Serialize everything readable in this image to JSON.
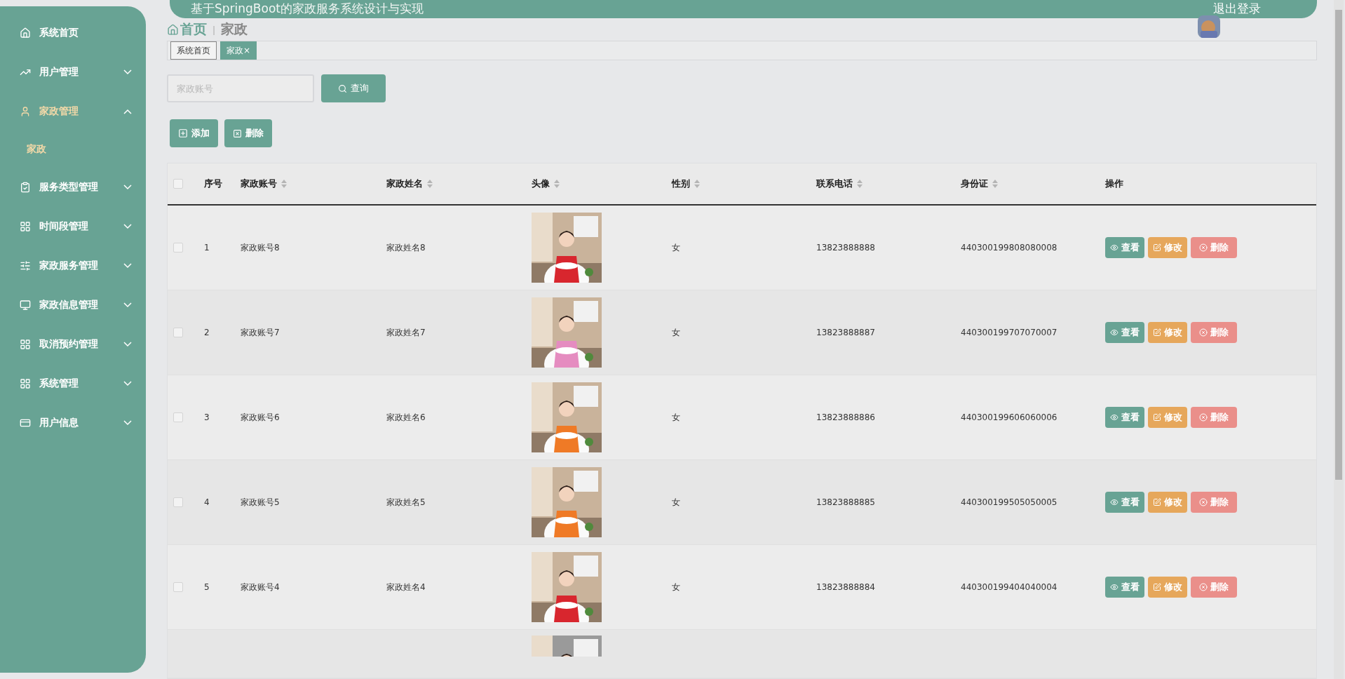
{
  "sidebar": {
    "items": [
      {
        "label": "系统首页",
        "kind": "link",
        "active": false
      },
      {
        "label": "用户管理",
        "kind": "group",
        "expanded": false,
        "active": false
      },
      {
        "label": "家政管理",
        "kind": "group",
        "expanded": true,
        "active": true,
        "children": [
          {
            "label": "家政",
            "selected": true
          }
        ]
      },
      {
        "label": "服务类型管理",
        "kind": "group",
        "expanded": false,
        "active": false
      },
      {
        "label": "时间段管理",
        "kind": "group",
        "expanded": false,
        "active": false
      },
      {
        "label": "家政服务管理",
        "kind": "group",
        "expanded": false,
        "active": false
      },
      {
        "label": "家政信息管理",
        "kind": "group",
        "expanded": false,
        "active": false
      },
      {
        "label": "取消预约管理",
        "kind": "group",
        "expanded": false,
        "active": false
      },
      {
        "label": "系统管理",
        "kind": "group",
        "expanded": false,
        "active": false
      },
      {
        "label": "用户信息",
        "kind": "group",
        "expanded": false,
        "active": false
      }
    ]
  },
  "header": {
    "title": "基于SpringBoot的家政服务系统设计与实现",
    "logout": "退出登录"
  },
  "breadcrumb": {
    "home": "首页",
    "separator": "ǀ",
    "current": "家政"
  },
  "tabs": [
    {
      "label": "系统首页",
      "selected": false
    },
    {
      "label": "家政",
      "selected": true,
      "close": "×"
    }
  ],
  "search": {
    "placeholder": "家政账号",
    "button": "查询"
  },
  "actions": {
    "add": "添加",
    "delete": "删除"
  },
  "table": {
    "columns": [
      {
        "label": "序号",
        "kind": "plain"
      },
      {
        "label": "家政账号",
        "kind": "sortable"
      },
      {
        "label": "家政姓名",
        "kind": "sortable"
      },
      {
        "label": "头像",
        "kind": "sortable"
      },
      {
        "label": "性别",
        "kind": "sortable"
      },
      {
        "label": "联系电话",
        "kind": "sortable"
      },
      {
        "label": "身份证",
        "kind": "sortable"
      },
      {
        "label": "操作",
        "kind": "plain"
      }
    ],
    "all_checked": false,
    "rows": [
      {
        "checked": false,
        "index": "1",
        "account": "家政账号8",
        "name": "家政姓名8",
        "gender": "女",
        "phone": "13823888888",
        "id_card": "440300199808080008",
        "buttons": [
          {
            "kind": "view",
            "label": "查看"
          },
          {
            "kind": "edit",
            "label": "修改"
          },
          {
            "kind": "delete",
            "label": "删除"
          }
        ]
      },
      {
        "checked": false,
        "index": "2",
        "account": "家政账号7",
        "name": "家政姓名7",
        "gender": "女",
        "phone": "13823888887",
        "id_card": "440300199707070007",
        "buttons": [
          {
            "kind": "view",
            "label": "查看"
          },
          {
            "kind": "edit",
            "label": "修改"
          },
          {
            "kind": "delete",
            "label": "删除"
          }
        ]
      },
      {
        "checked": false,
        "index": "3",
        "account": "家政账号6",
        "name": "家政姓名6",
        "gender": "女",
        "phone": "13823888886",
        "id_card": "440300199606060006",
        "buttons": [
          {
            "kind": "view",
            "label": "查看"
          },
          {
            "kind": "edit",
            "label": "修改"
          },
          {
            "kind": "delete",
            "label": "删除"
          }
        ]
      },
      {
        "checked": false,
        "index": "4",
        "account": "家政账号5",
        "name": "家政姓名5",
        "gender": "女",
        "phone": "13823888885",
        "id_card": "440300199505050005",
        "buttons": [
          {
            "kind": "view",
            "label": "查看"
          },
          {
            "kind": "edit",
            "label": "修改"
          },
          {
            "kind": "delete",
            "label": "删除"
          }
        ]
      },
      {
        "checked": false,
        "index": "5",
        "account": "家政账号4",
        "name": "家政姓名4",
        "gender": "女",
        "phone": "13823888884",
        "id_card": "440300199404040004",
        "buttons": [
          {
            "kind": "view",
            "label": "查看"
          },
          {
            "kind": "edit",
            "label": "修改"
          },
          {
            "kind": "delete",
            "label": "删除"
          }
        ]
      }
    ]
  }
}
